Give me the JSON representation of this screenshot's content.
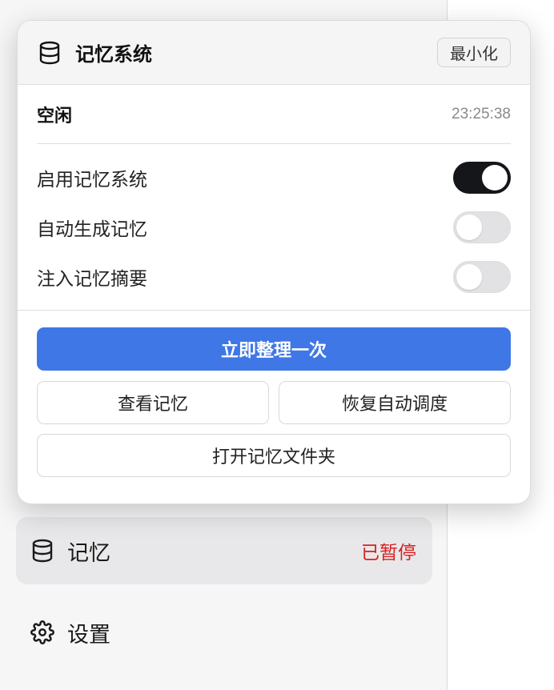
{
  "popup": {
    "title": "记忆系统",
    "minimize_label": "最小化",
    "status": "空闲",
    "time": "23:25:38",
    "toggles": [
      {
        "label": "启用记忆系统",
        "on": true
      },
      {
        "label": "自动生成记忆",
        "on": false
      },
      {
        "label": "注入记忆摘要",
        "on": false
      }
    ],
    "primary_action": "立即整理一次",
    "view_memory": "查看记忆",
    "resume_schedule": "恢复自动调度",
    "open_folder": "打开记忆文件夹"
  },
  "sidebar": {
    "memory_label": "记忆",
    "memory_status": "已暂停",
    "settings_label": "设置"
  },
  "colors": {
    "primary": "#4077e6",
    "status_paused": "#d92020",
    "toggle_on": "#15161a"
  },
  "icons": {
    "memory": "database-icon",
    "settings": "gear-icon"
  }
}
